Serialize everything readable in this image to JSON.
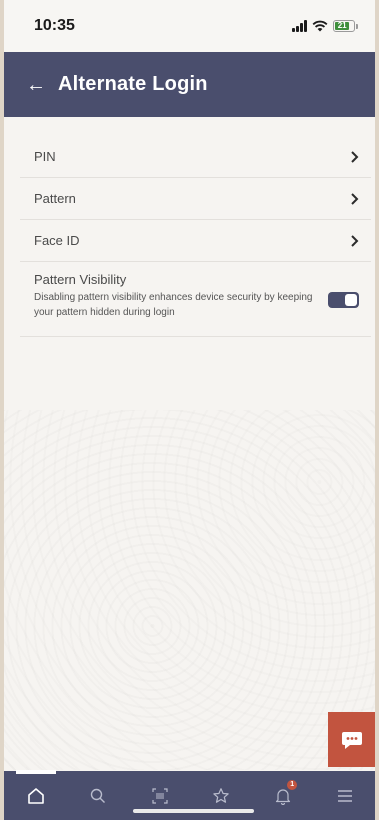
{
  "status_bar": {
    "time": "10:35",
    "battery": "21",
    "icons": [
      "signal-icon",
      "wifi-icon",
      "battery-icon"
    ]
  },
  "header": {
    "back_icon": "arrow-left-icon",
    "title": "Alternate Login"
  },
  "settings": {
    "items": [
      {
        "label": "PIN",
        "icon": "chevron-right-icon"
      },
      {
        "label": "Pattern",
        "icon": "chevron-right-icon"
      },
      {
        "label": "Face ID",
        "icon": "chevron-right-icon"
      }
    ],
    "pattern_visibility": {
      "title": "Pattern Visibility",
      "description": "Disabling pattern visibility enhances device security by keeping your pattern hidden during login",
      "enabled": true
    }
  },
  "chat_fab": {
    "icon": "chat-icon",
    "color": "#c2543f"
  },
  "bottom_nav": {
    "items": [
      {
        "name": "home",
        "icon": "home-icon",
        "active": true
      },
      {
        "name": "search",
        "icon": "search-icon",
        "active": false
      },
      {
        "name": "scan",
        "icon": "barcode-scan-icon",
        "active": false
      },
      {
        "name": "favorites",
        "icon": "star-icon",
        "active": false
      },
      {
        "name": "notifications",
        "icon": "bell-icon",
        "active": false,
        "badge": "1"
      },
      {
        "name": "menu",
        "icon": "hamburger-menu-icon",
        "active": false
      }
    ]
  },
  "colors": {
    "header_bg": "#4a4e6d",
    "accent": "#c2543f",
    "page_bg": "#f6f4f1"
  }
}
